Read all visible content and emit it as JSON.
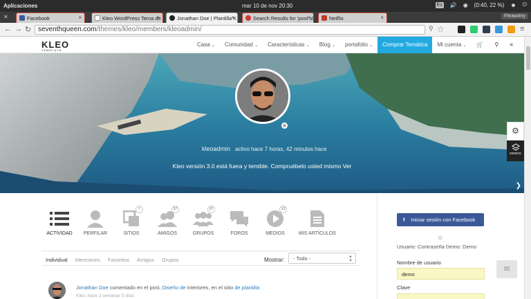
{
  "os": {
    "apps": "Aplicaciones",
    "clock": "mar 10 de nov   20:30",
    "keyboard": "Es",
    "battery": "(0:40, 22 %)"
  },
  "tabs": [
    {
      "label": "Facebook",
      "favcolor": "#3b5998"
    },
    {
      "label": "Kleo WordPress Tema de",
      "favcolor": "#ffffff"
    },
    {
      "label": "Jonathan Doe | Plantilla K",
      "favcolor": "#222222"
    },
    {
      "label": "Search Results for 'post sl",
      "favcolor": "#d13b2f"
    },
    {
      "label": "Netflix",
      "favcolor": "#c0392b"
    }
  ],
  "browser": {
    "user": "Fitraw4rty",
    "url_host": "seventhqueen.com",
    "url_path": "/themes/kleo/members/kleoadmin/"
  },
  "site": {
    "logo": "KLEO",
    "logo_sub": "TEMPLATE",
    "nav": [
      "Casa",
      "Comunidad",
      "Características",
      "Blog",
      "portafolio"
    ],
    "cta": "Comprar Temática",
    "account": "Mi cuenta",
    "menu_icons": [
      "cart-icon",
      "search-icon",
      "menu-icon"
    ]
  },
  "profile": {
    "username": "kleoadmin",
    "active": "activo hace 7 horas, 42 minutos hace",
    "tagline": "Kleo versión 3.0 está fuera y temible. Compruébelo usted mismo Ver"
  },
  "side_widgets": {
    "demos": "DEMOS"
  },
  "tabs_profile": [
    {
      "label": "ACTIVIDAD",
      "count": "",
      "icon": "activity-icon"
    },
    {
      "label": "PERFILAR",
      "count": "",
      "icon": "profile-icon"
    },
    {
      "label": "SITIOS",
      "count": "7",
      "icon": "sites-icon"
    },
    {
      "label": "AMIGOS",
      "count": "37",
      "icon": "friends-icon"
    },
    {
      "label": "GRUPOS",
      "count": "37",
      "icon": "groups-icon"
    },
    {
      "label": "FOROS",
      "count": "",
      "icon": "forums-icon"
    },
    {
      "label": "MEDIOS",
      "count": "12",
      "icon": "media-icon"
    },
    {
      "label": "MIS ARTÍCULOS",
      "count": "",
      "icon": "articles-icon"
    }
  ],
  "filters": [
    "Individual",
    "Menciones",
    "Favoritos",
    "Amigos",
    "Grupos"
  ],
  "show": {
    "label": "Mostrar:",
    "value": "- Todo -"
  },
  "activity": {
    "author": "Jonathan Doe",
    "text1": "comentado en el post,",
    "post": "Diseño de",
    "text2": "interiores, en el sitio",
    "site": "de plantilla",
    "time": "Kleo, hace 2 semanas 5 días"
  },
  "login": {
    "facebook": "Iniciar sesión con Facebook",
    "or": "O",
    "demo": "Usuario: Contraseña Demo: Demo",
    "user_label": "Nombre de usuario",
    "user_value": "demo",
    "pass_label": "Clave"
  }
}
